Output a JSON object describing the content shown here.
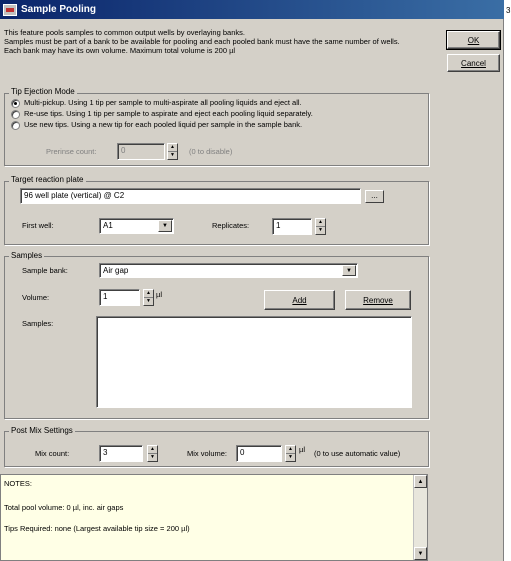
{
  "window": {
    "title": "Sample Pooling",
    "edge_mark": "3"
  },
  "intro": {
    "line1": "This feature pools samples to common output wells by overlaying banks.",
    "line2": "Samples must be part of a bank to be available for pooling and each pooled bank must have the same number of wells.",
    "line3": "Each bank may have its own volume. Maximum total volume is 200 µl"
  },
  "buttons": {
    "ok": "OK",
    "cancel": "Cancel",
    "add": "Add",
    "remove": "Remove",
    "browse": "..."
  },
  "tip_ejection": {
    "title": "Tip Ejection Mode",
    "options": [
      {
        "label": "Multi-pickup. Using 1 tip per sample to multi-aspirate all pooling liquids and eject all.",
        "checked": true
      },
      {
        "label": "Re-use tips. Using 1 tip per sample to aspirate and eject each pooling liquid separately.",
        "checked": false
      },
      {
        "label": "Use new tips. Using a new tip for each pooled liquid per sample in the sample bank.",
        "checked": false
      }
    ],
    "prerinse_label": "Prerinse count:",
    "prerinse_value": "0",
    "prerinse_hint": "(0 to disable)"
  },
  "target": {
    "title": "Target reaction plate",
    "plate": "96 well plate (vertical) @ C2",
    "first_well_label": "First well:",
    "first_well_value": "A1",
    "replicates_label": "Replicates:",
    "replicates_value": "1"
  },
  "samples": {
    "title": "Samples",
    "bank_label": "Sample bank:",
    "bank_value": "Air gap",
    "volume_label": "Volume:",
    "volume_value": "1",
    "volume_unit": "µl",
    "list_label": "Samples:"
  },
  "post_mix": {
    "title": "Post Mix Settings",
    "count_label": "Mix count:",
    "count_value": "3",
    "volume_label": "Mix volume:",
    "volume_value": "0",
    "volume_unit": "µl",
    "volume_hint": "(0 to use automatic value)"
  },
  "notes": {
    "heading": "NOTES:",
    "line1": "Total pool volume: 0 µl, inc. air gaps",
    "line2": "Tips Required: none  (Largest available tip size = 200 µl)"
  }
}
